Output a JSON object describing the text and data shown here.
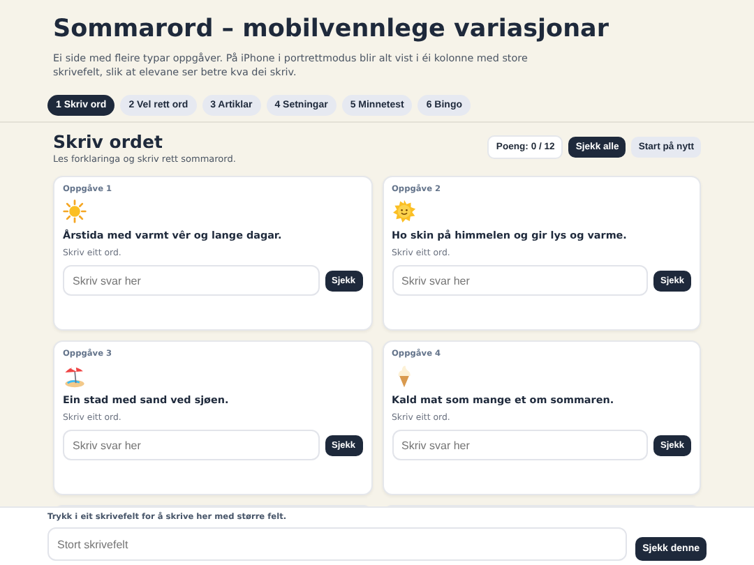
{
  "header": {
    "title": "Sommarord – mobilvennlege variasjonar",
    "description": "Ei side med fleire typar oppgåver. På iPhone i portrettmodus blir alt vist i éi kolonne med store skrivefelt, slik at elevane ser betre kva dei skriv."
  },
  "tabs": [
    {
      "label": "1 Skriv ord",
      "selected": true
    },
    {
      "label": "2 Vel rett ord",
      "selected": false
    },
    {
      "label": "3 Artiklar",
      "selected": false
    },
    {
      "label": "4 Setningar",
      "selected": false
    },
    {
      "label": "5 Minnetest",
      "selected": false
    },
    {
      "label": "6 Bingo",
      "selected": false
    }
  ],
  "section": {
    "title": "Skriv ordet",
    "subtitle": "Les forklaringa og skriv rett sommarord.",
    "score": "Poeng: 0 / 12",
    "check_all": "Sjekk alle",
    "restart": "Start på nytt"
  },
  "tasks": [
    {
      "label": "Oppgåve 1",
      "clue": "Årstida med varmt vêr og lange dagar.",
      "hint": "Skriv eitt ord.",
      "placeholder": "Skriv svar her",
      "button": "Sjekk"
    },
    {
      "label": "Oppgåve 2",
      "clue": "Ho skin på himmelen og gir lys og varme.",
      "hint": "Skriv eitt ord.",
      "placeholder": "Skriv svar her",
      "button": "Sjekk"
    },
    {
      "label": "Oppgåve 3",
      "clue": "Ein stad med sand ved sjøen.",
      "hint": "Skriv eitt ord.",
      "placeholder": "Skriv svar her",
      "button": "Sjekk"
    },
    {
      "label": "Oppgåve 4",
      "clue": "Kald mat som mange et om sommaren.",
      "hint": "Skriv eitt ord.",
      "placeholder": "Skriv svar her",
      "button": "Sjekk"
    }
  ],
  "bottom_bar": {
    "hint": "Trykk i eit skrivefelt for å skrive her med større felt.",
    "placeholder": "Stort skrivefelt",
    "button": "Sjekk denne"
  }
}
